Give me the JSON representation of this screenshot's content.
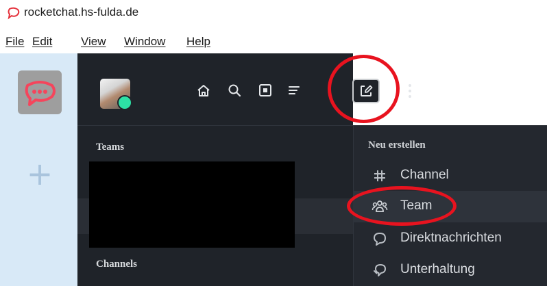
{
  "window": {
    "title": "rocketchat.hs-fulda.de",
    "icon": "rocketchat-app-icon"
  },
  "menu": [
    "File",
    "Edit",
    "View",
    "Window",
    "Help"
  ],
  "server_strip": {
    "workspace_icon": "rocketchat-logo-icon",
    "add_icon": "plus-icon"
  },
  "sidebar": {
    "toolbar_icons": [
      "home-icon",
      "search-icon",
      "directory-icon",
      "sort-icon",
      "create-new-icon",
      "kebab-menu-icon"
    ],
    "sections": {
      "teams": "Teams",
      "channels": "Channels"
    }
  },
  "create_menu": {
    "title": "Neu erstellen",
    "items": [
      {
        "label": "Channel",
        "icon": "hashtag-icon"
      },
      {
        "label": "Team",
        "icon": "team-icon"
      },
      {
        "label": "Direktnachrichten",
        "icon": "direct-message-icon"
      },
      {
        "label": "Unterhaltung",
        "icon": "discussion-icon"
      }
    ]
  },
  "colors": {
    "sidebar_bg": "#1f2329",
    "menu_bg": "#24282f",
    "server_strip_bg": "#d8e9f7",
    "status_online": "#2de0a5",
    "highlight_ring": "#e8131f"
  }
}
